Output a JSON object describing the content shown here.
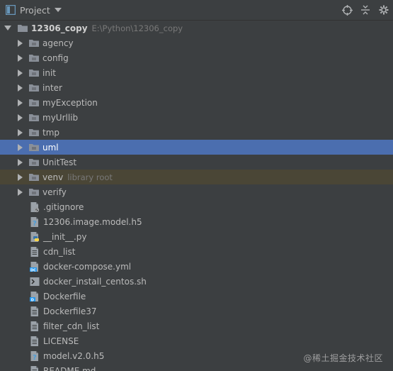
{
  "header": {
    "title": "Project",
    "icons": [
      "project-view-icon",
      "locate-icon",
      "collapse-all-icon",
      "settings-icon"
    ]
  },
  "root": {
    "name": "12306_copy",
    "path": "E:\\Python\\12306_copy"
  },
  "folders": [
    {
      "name": "agency"
    },
    {
      "name": "config"
    },
    {
      "name": "init"
    },
    {
      "name": "inter"
    },
    {
      "name": "myException"
    },
    {
      "name": "myUrllib"
    },
    {
      "name": "tmp"
    },
    {
      "name": "uml",
      "selected": true
    },
    {
      "name": "UnitTest"
    },
    {
      "name": "venv",
      "hint": "library root"
    },
    {
      "name": "verify"
    }
  ],
  "files": [
    {
      "name": ".gitignore",
      "icon": "gitignore-file-icon"
    },
    {
      "name": "12306.image.model.h5",
      "icon": "unknown-file-icon"
    },
    {
      "name": "__init__.py",
      "icon": "python-file-icon"
    },
    {
      "name": "cdn_list",
      "icon": "text-file-icon"
    },
    {
      "name": "docker-compose.yml",
      "icon": "docker-compose-file-icon"
    },
    {
      "name": "docker_install_centos.sh",
      "icon": "shell-script-file-icon"
    },
    {
      "name": "Dockerfile",
      "icon": "dockerfile-icon"
    },
    {
      "name": "Dockerfile37",
      "icon": "text-file-icon"
    },
    {
      "name": "filter_cdn_list",
      "icon": "text-file-icon"
    },
    {
      "name": "LICENSE",
      "icon": "text-file-icon"
    },
    {
      "name": "model.v2.0.h5",
      "icon": "unknown-file-icon"
    },
    {
      "name": "README.md",
      "icon": "text-file-icon"
    }
  ],
  "watermark": "@稀土掘金技术社区",
  "colors": {
    "background": "#3c3f41",
    "selection": "#4b6eaf",
    "library_root_row": "#4a4636",
    "folder": "#8a9099",
    "text": "#bbbbbb"
  }
}
